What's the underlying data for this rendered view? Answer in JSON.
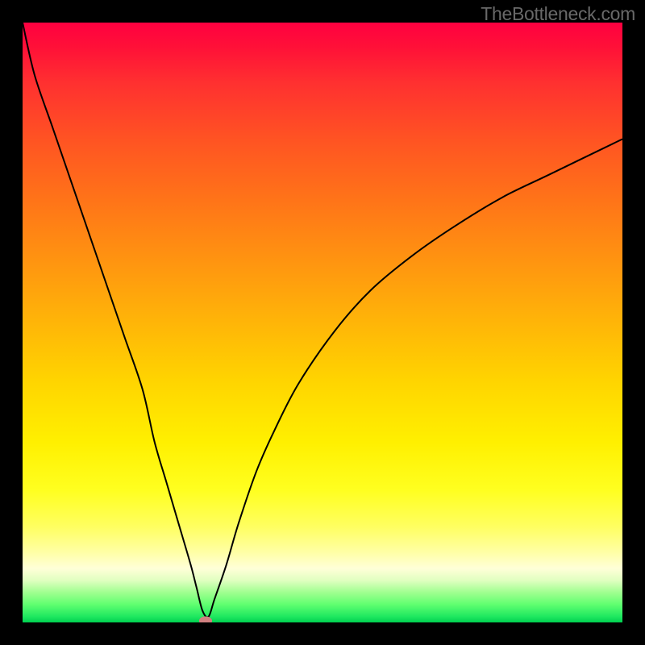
{
  "watermark": "TheBottleneck.com",
  "chart_data": {
    "type": "line",
    "title": "",
    "xlabel": "",
    "ylabel": "",
    "x": [
      0,
      2,
      5,
      8,
      11,
      14,
      17,
      20,
      22,
      24,
      26,
      28,
      29,
      30,
      31,
      32,
      34,
      36,
      39,
      42,
      46,
      52,
      58,
      65,
      72,
      80,
      88,
      100
    ],
    "values": [
      103,
      94,
      85,
      76,
      67,
      58,
      49,
      40,
      31,
      24,
      17,
      10,
      6,
      2,
      1,
      4,
      10,
      17,
      26,
      33,
      41,
      50,
      57,
      63,
      68,
      73,
      77,
      83
    ],
    "ylim": [
      0,
      103
    ],
    "xlim": [
      0,
      100
    ],
    "marker": {
      "x": 30.5,
      "y": 0.3
    }
  },
  "colors": {
    "frame": "#000000",
    "top": "#ff0040",
    "bottom": "#00d050",
    "curve": "#000000",
    "marker": "#d08080"
  }
}
